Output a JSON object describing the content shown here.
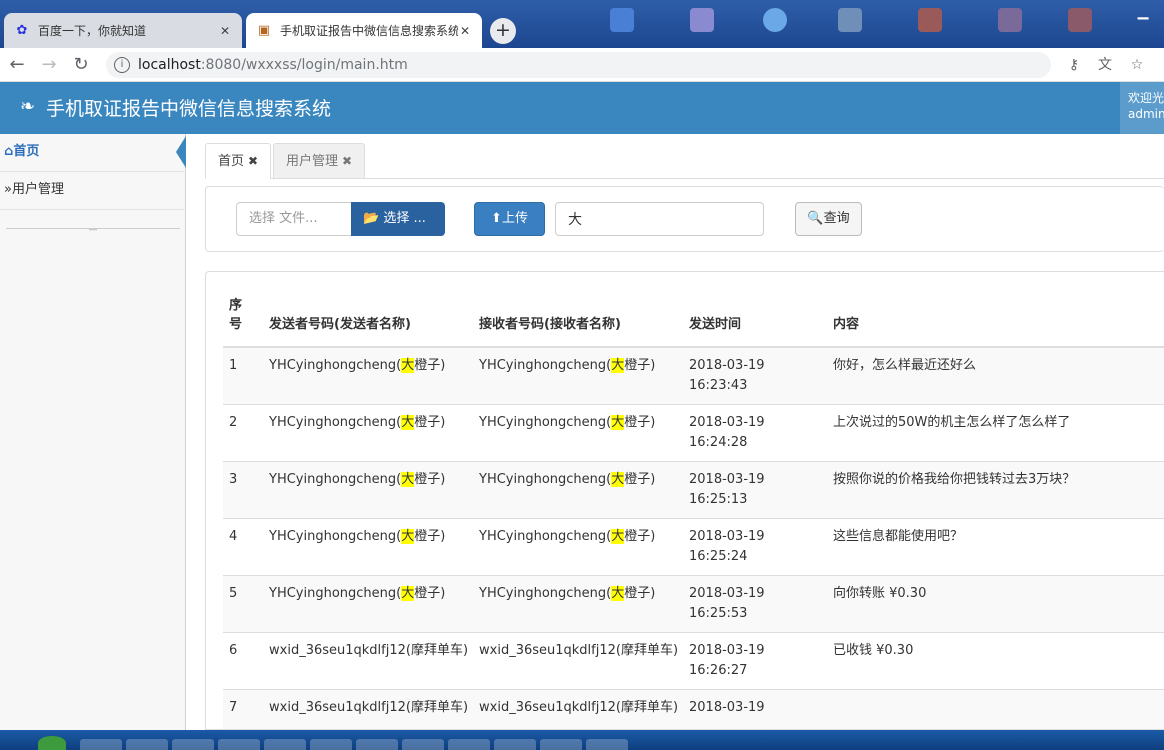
{
  "browser": {
    "tabs": [
      {
        "title": "百度一下，你就知道",
        "icon": "baidu-paw-icon",
        "active": false
      },
      {
        "title": "手机取证报告中微信信息搜索系统",
        "icon": "page-favicon",
        "active": true
      }
    ],
    "new_tab": "+",
    "url_host": "localhost",
    "url_path": ":8080/wxxxss/login/main.htm"
  },
  "app": {
    "title": "手机取证报告中微信信息搜索系统",
    "welcome_line1": "欢迎光",
    "welcome_line2": "admin",
    "header_color": "#3a87c0"
  },
  "sidebar": {
    "items": [
      {
        "label": "首页",
        "icon": "home-icon"
      },
      {
        "label": "用户管理",
        "icon": "double-chevron-icon"
      }
    ]
  },
  "page_tabs": [
    {
      "label": "首页",
      "close": "✖"
    },
    {
      "label": "用户管理",
      "close": "✖"
    }
  ],
  "toolbar": {
    "file_placeholder": "选择 文件...",
    "select_label": "选择 ...",
    "upload_label": "上传",
    "search_value": "大",
    "query_label": "查询"
  },
  "table": {
    "headers": [
      "序号",
      "发送者号码(发送者名称)",
      "接收者号码(接收者名称)",
      "发送时间",
      "内容"
    ],
    "rows": [
      {
        "idx": "1",
        "sender_pre": "YHCyinghongcheng(",
        "sender_hl": "大",
        "sender_post": "橙子)",
        "receiver_pre": "YHCyinghongcheng(",
        "receiver_hl": "大",
        "receiver_post": "橙子)",
        "date": "2018-03-19",
        "time": "16:23:43",
        "content": "你好，怎么样最近还好么"
      },
      {
        "idx": "2",
        "sender_pre": "YHCyinghongcheng(",
        "sender_hl": "大",
        "sender_post": "橙子)",
        "receiver_pre": "YHCyinghongcheng(",
        "receiver_hl": "大",
        "receiver_post": "橙子)",
        "date": "2018-03-19",
        "time": "16:24:28",
        "content": "上次说过的50W的机主怎么样了怎么样了"
      },
      {
        "idx": "3",
        "sender_pre": "YHCyinghongcheng(",
        "sender_hl": "大",
        "sender_post": "橙子)",
        "receiver_pre": "YHCyinghongcheng(",
        "receiver_hl": "大",
        "receiver_post": "橙子)",
        "date": "2018-03-19",
        "time": "16:25:13",
        "content": "按照你说的价格我给你把钱转过去3万块？"
      },
      {
        "idx": "4",
        "sender_pre": "YHCyinghongcheng(",
        "sender_hl": "大",
        "sender_post": "橙子)",
        "receiver_pre": "YHCyinghongcheng(",
        "receiver_hl": "大",
        "receiver_post": "橙子)",
        "date": "2018-03-19",
        "time": "16:25:24",
        "content": "这些信息都能使用吧？"
      },
      {
        "idx": "5",
        "sender_pre": "YHCyinghongcheng(",
        "sender_hl": "大",
        "sender_post": "橙子)",
        "receiver_pre": "YHCyinghongcheng(",
        "receiver_hl": "大",
        "receiver_post": "橙子)",
        "date": "2018-03-19",
        "time": "16:25:53",
        "content": "向你转账 ¥0.30"
      },
      {
        "idx": "6",
        "sender_pre": "wxid_36seu1qkdlfj12(摩拜单车)",
        "sender_hl": "",
        "sender_post": "",
        "receiver_pre": "wxid_36seu1qkdlfj12(摩拜单车)",
        "receiver_hl": "",
        "receiver_post": "",
        "date": "2018-03-19",
        "time": "16:26:27",
        "content": "已收钱 ¥0.30"
      },
      {
        "idx": "7",
        "sender_pre": "wxid_36seu1qkdlfj12(摩拜单车)",
        "sender_hl": "",
        "sender_post": "",
        "receiver_pre": "wxid_36seu1qkdlfj12(摩拜单车)",
        "receiver_hl": "",
        "receiver_post": "",
        "date": "2018-03-19",
        "time": "",
        "content": ""
      }
    ]
  }
}
